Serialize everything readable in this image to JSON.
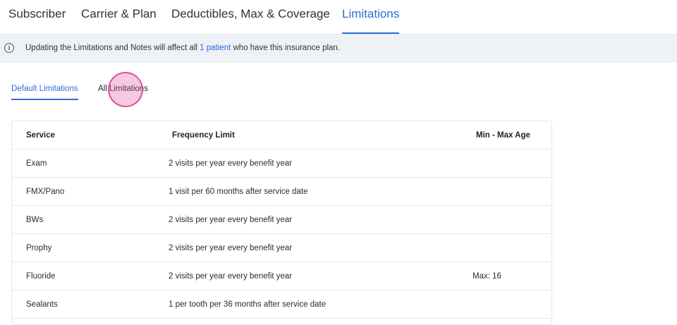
{
  "tabs": [
    {
      "label": "Subscriber"
    },
    {
      "label": "Carrier & Plan"
    },
    {
      "label": "Deductibles, Max & Coverage"
    },
    {
      "label": "Limitations",
      "active": true
    }
  ],
  "banner": {
    "icon": "info-icon",
    "text_before": "Updating the Limitations and Notes will affect all ",
    "link_text": "1 patient",
    "text_after": " who have this insurance plan."
  },
  "sub_tabs": [
    {
      "label": "Default Limitations",
      "active": true
    },
    {
      "label": "All Limitations",
      "active": false
    }
  ],
  "table": {
    "headers": [
      "Service",
      "Frequency Limit",
      "Min - Max Age"
    ],
    "rows": [
      {
        "service": "Exam",
        "frequency": "2 visits per year every benefit year",
        "age": ""
      },
      {
        "service": "FMX/Pano",
        "frequency": "1 visit per 60 months after service date",
        "age": ""
      },
      {
        "service": "BWs",
        "frequency": "2 visits per year every benefit year",
        "age": ""
      },
      {
        "service": "Prophy",
        "frequency": "2 visits per year every benefit year",
        "age": ""
      },
      {
        "service": "Fluoride",
        "frequency": "2 visits per year every benefit year",
        "age": "Max: 16"
      },
      {
        "service": "Sealants",
        "frequency": "1 per tooth per 36 months after service date",
        "age": ""
      }
    ]
  },
  "colors": {
    "accent": "#2f6bd9",
    "banner_bg": "#eef1f6",
    "border": "#e3e6ea"
  }
}
